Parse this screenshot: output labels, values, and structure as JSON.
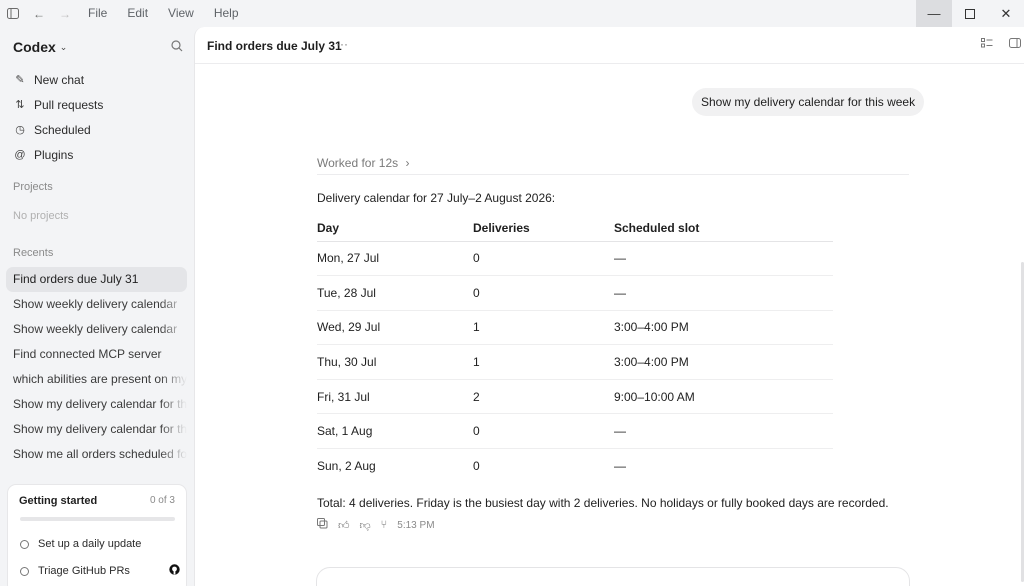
{
  "titlebar": {
    "menus": [
      "File",
      "Edit",
      "View",
      "Help"
    ]
  },
  "sidebar": {
    "brand": "Codex",
    "nav": [
      {
        "label": "New chat",
        "icon": "edit-icon"
      },
      {
        "label": "Pull requests",
        "icon": "pull-request-icon"
      },
      {
        "label": "Scheduled",
        "icon": "clock-icon"
      },
      {
        "label": "Plugins",
        "icon": "plugin-icon"
      }
    ],
    "projects_label": "Projects",
    "projects_empty": "No projects",
    "recents_label": "Recents",
    "recents": [
      "Find orders due July 31",
      "Show weekly delivery calendar",
      "Show weekly delivery calendar",
      "Find connected MCP server",
      "which abilities are present on my",
      "Show my delivery calendar for thi",
      "Show my delivery calendar for thi",
      "Show me all orders scheduled for"
    ],
    "getting_started": {
      "title": "Getting started",
      "count": "0 of 3",
      "progress": 0,
      "items": [
        "Set up a daily update",
        "Triage GitHub PRs"
      ]
    }
  },
  "main": {
    "thread_title": "Find orders due July 31",
    "more": "···",
    "user_message": "Show my delivery calendar for this week",
    "worked_for": "Worked for 12s",
    "intro": "Delivery calendar for 27 July–2 August 2026:",
    "table": {
      "headers": [
        "Day",
        "Deliveries",
        "Scheduled slot"
      ],
      "rows": [
        [
          "Mon, 27 Jul",
          "0",
          "—"
        ],
        [
          "Tue, 28 Jul",
          "0",
          "—"
        ],
        [
          "Wed, 29 Jul",
          "1",
          "3:00–4:00 PM"
        ],
        [
          "Thu, 30 Jul",
          "1",
          "3:00–4:00 PM"
        ],
        [
          "Fri, 31 Jul",
          "2",
          "9:00–10:00 AM"
        ],
        [
          "Sat, 1 Aug",
          "0",
          "—"
        ],
        [
          "Sun, 2 Aug",
          "0",
          "—"
        ]
      ]
    },
    "summary": "Total: 4 deliveries. Friday is the busiest day with 2 deliveries. No holidays or fully booked days are recorded.",
    "timestamp": "5:13 PM"
  }
}
